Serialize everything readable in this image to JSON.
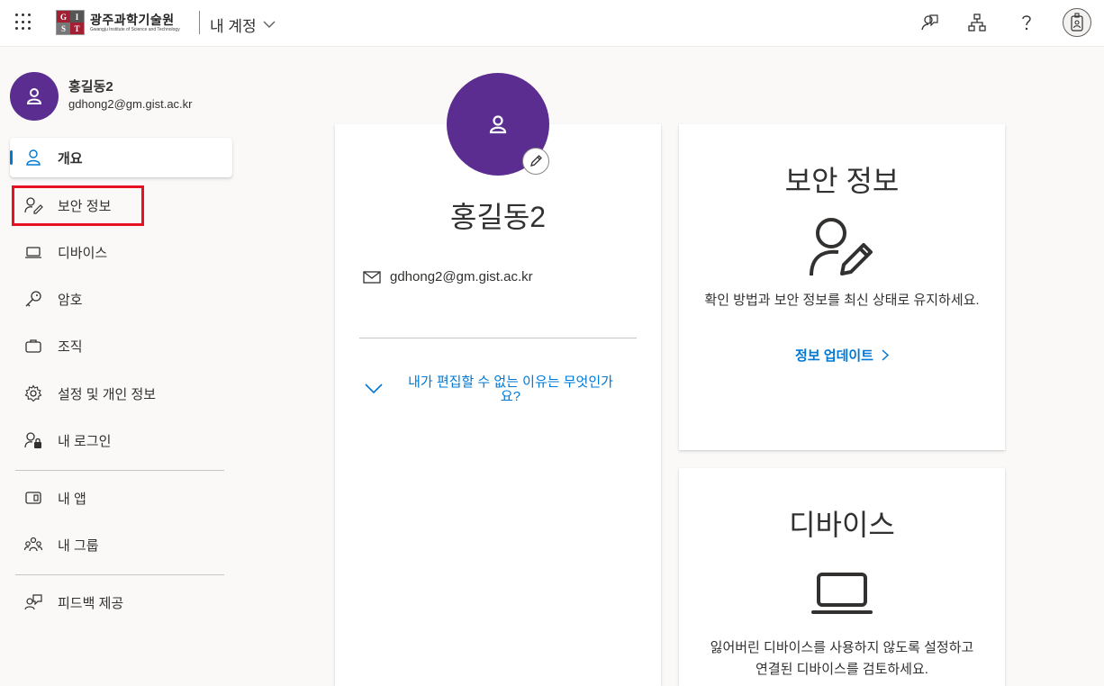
{
  "header": {
    "logo_kr": "광주과학기술원",
    "logo_en": "Gwangju Institute of Science and Technology",
    "logo_letters": [
      "G",
      "I",
      "S",
      "T"
    ],
    "title": "내 계정",
    "icons": [
      "waffle-icon",
      "feedback-icon",
      "org-chart-icon",
      "help-icon",
      "user-badge-icon"
    ]
  },
  "profile": {
    "name": "홍길동2",
    "email": "gdhong2@gm.gist.ac.kr"
  },
  "sidebar": {
    "items": [
      {
        "label": "개요",
        "icon": "person-icon",
        "active": true
      },
      {
        "label": "보안 정보",
        "icon": "person-edit-icon",
        "active": false
      },
      {
        "label": "디바이스",
        "icon": "laptop-icon",
        "active": false
      },
      {
        "label": "암호",
        "icon": "key-icon",
        "active": false
      },
      {
        "label": "조직",
        "icon": "briefcase-icon",
        "active": false
      },
      {
        "label": "설정 및 개인 정보",
        "icon": "gear-icon",
        "active": false
      },
      {
        "label": "내 로그인",
        "icon": "person-lock-icon",
        "active": false
      },
      {
        "label": "내 앱",
        "icon": "apps-icon",
        "active": false
      },
      {
        "label": "내 그룹",
        "icon": "people-icon",
        "active": false
      },
      {
        "label": "피드백 제공",
        "icon": "feedback-icon",
        "active": false
      }
    ]
  },
  "overview_card": {
    "name": "홍길동2",
    "email": "gdhong2@gm.gist.ac.kr",
    "why_cant_edit": "내가 편집할 수 없는 이유는 무엇인가요?"
  },
  "security_card": {
    "title": "보안 정보",
    "description": "확인 방법과 보안 정보를 최신 상태로 유지하세요.",
    "link": "정보 업데이트"
  },
  "devices_card": {
    "title": "디바이스",
    "description_line1": "잃어버린 디바이스를 사용하지 않도록 설정하고",
    "description_line2": "연결된 디바이스를 검토하세요."
  },
  "colors": {
    "accent": "#0078d4",
    "avatar": "#5c2d91",
    "highlight": "#e81123"
  }
}
